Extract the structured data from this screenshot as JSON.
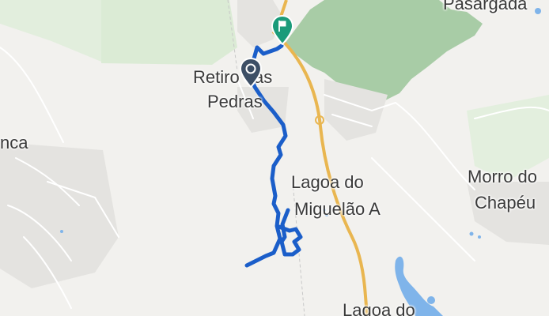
{
  "map": {
    "places": {
      "pasargada": "Pasargada",
      "retiro_line1": "Retiro das",
      "retiro_line2": "Pedras",
      "lagoa_miguelao_line1": "Lagoa do",
      "lagoa_miguelao_line2": "Miguelão A",
      "morro_line1": "Morro do",
      "morro_line2": "Chapéu",
      "lagoa_do_bottom": "Lagoa do",
      "left_edge": "nca"
    },
    "colors": {
      "background": "#f2f1ee",
      "park_green": "#a8cca6",
      "forest_green": "#dbebd5",
      "route_blue": "#1b5ec9",
      "start_marker": "#3d4f66",
      "end_marker": "#1a9b7a",
      "highway": "#e9b650",
      "water": "#7fb4ea"
    },
    "markers": {
      "start": "start-pin-icon",
      "end": "flag-pin-icon"
    }
  }
}
